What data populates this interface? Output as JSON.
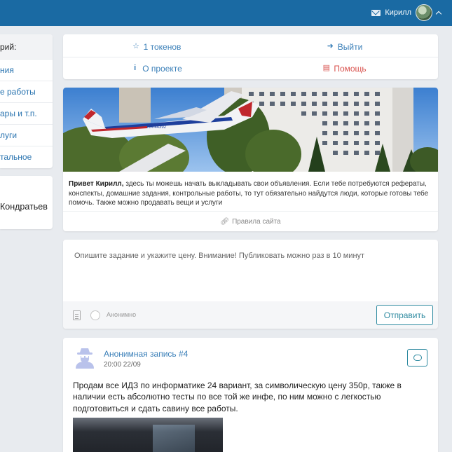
{
  "topbar": {
    "user_name": "Кирилл",
    "color": "#1a6aa3"
  },
  "sidebar": {
    "heading": "рий:",
    "items": [
      {
        "label": "ния"
      },
      {
        "label": "е работы"
      },
      {
        "label": "ары и т.п."
      },
      {
        "label": "луги"
      },
      {
        "label": "тальное"
      }
    ],
    "user_card_name": "Кондратьев"
  },
  "menu": {
    "tokens_label": "1 токенов",
    "logout_label": "Выйти",
    "about_label": "О проекте",
    "help_label": "Помощь"
  },
  "welcome": {
    "greeting": "Привет Кирилл,",
    "text": " здесь ты можешь начать выкладывать свои объявления. Если тебе потребуются рефераты, конспекты, домашние задания, контрольные работы, то тут обязательно найдутся люди, которые готовы тебе помочь. Также можно продавать вещи и услуги",
    "rules_label": "Правила сайта",
    "plane_registration": "RA-44392"
  },
  "composer": {
    "placeholder": "Опишите задание и укажите цену. Внимание! Публиковать можно раз в 10 минут",
    "anonymous_label": "Анонимно",
    "send_label": "Отправить"
  },
  "post": {
    "title": "Анонимная запись #4",
    "time": "20:00 22/09",
    "body": "Продам все ИДЗ по информатике 24 вариант, за символическую цену 350р, также в наличии есть абсолютно тесты по все той же инфе, по ним можно с легкостью подготовиться и сдать савину все работы."
  },
  "colors": {
    "accent": "#1a6aa3",
    "link": "#3a7fb8",
    "danger": "#d9534f",
    "button": "#2e8aa0",
    "background": "#e8ebef"
  }
}
